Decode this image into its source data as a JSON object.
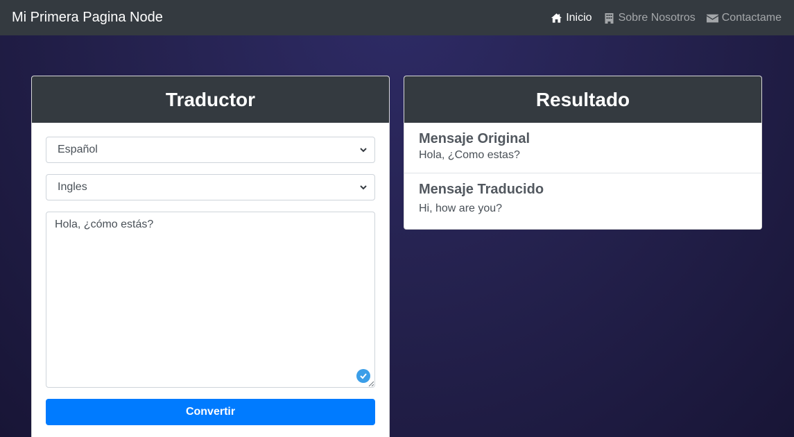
{
  "navbar": {
    "brand": "Mi Primera Pagina Node",
    "links": [
      {
        "label": "Inicio",
        "icon": "home-icon",
        "active": true
      },
      {
        "label": "Sobre Nosotros",
        "icon": "building-icon",
        "active": false
      },
      {
        "label": "Contactame",
        "icon": "envelope-icon",
        "active": false
      }
    ]
  },
  "translator": {
    "title": "Traductor",
    "source_language": "Español",
    "target_language": "Ingles",
    "input_text": "Hola, ¿cómo estás?",
    "button_label": "Convertir"
  },
  "result": {
    "title": "Resultado",
    "original_label": "Mensaje Original",
    "original_text": "Hola, ¿Como estas?",
    "translated_label": "Mensaje Traducido",
    "translated_text": "Hi, how are you?"
  },
  "colors": {
    "navbar_bg": "#343a40",
    "primary": "#007bff",
    "background": "#25224f"
  }
}
